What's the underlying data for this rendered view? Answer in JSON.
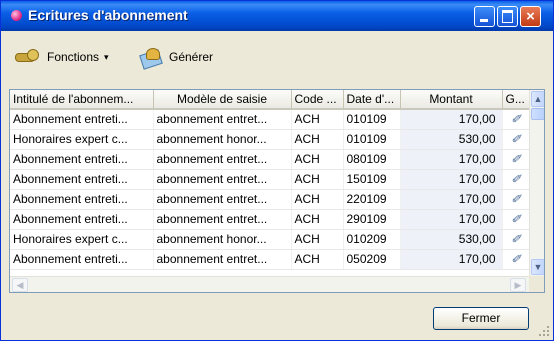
{
  "window": {
    "title": "Ecritures d'abonnement",
    "controls": {
      "minimize": "minimize",
      "maximize": "maximize",
      "close": "×"
    }
  },
  "toolbar": {
    "fonctions_label": "Fonctions",
    "fonctions_caret": "▾",
    "fonctions_icon": "keys-icon",
    "generer_label": "Générer",
    "generer_icon": "generate-icon"
  },
  "table": {
    "columns": [
      "Intitulé de l'abonnem...",
      "Modèle de saisie",
      "Code ...",
      "Date d'...",
      "Montant",
      "G..."
    ],
    "rows": [
      {
        "intitule": "Abonnement entreti...",
        "modele": "abonnement entret...",
        "code": "ACH",
        "date": "010109",
        "montant": "170,00",
        "g": "✐"
      },
      {
        "intitule": "Honoraires expert c...",
        "modele": "abonnement honor...",
        "code": "ACH",
        "date": "010109",
        "montant": "530,00",
        "g": "✐"
      },
      {
        "intitule": "Abonnement entreti...",
        "modele": "abonnement entret...",
        "code": "ACH",
        "date": "080109",
        "montant": "170,00",
        "g": "✐"
      },
      {
        "intitule": "Abonnement entreti...",
        "modele": "abonnement entret...",
        "code": "ACH",
        "date": "150109",
        "montant": "170,00",
        "g": "✐"
      },
      {
        "intitule": "Abonnement entreti...",
        "modele": "abonnement entret...",
        "code": "ACH",
        "date": "220109",
        "montant": "170,00",
        "g": "✐"
      },
      {
        "intitule": "Abonnement entreti...",
        "modele": "abonnement entret...",
        "code": "ACH",
        "date": "290109",
        "montant": "170,00",
        "g": "✐"
      },
      {
        "intitule": "Honoraires expert c...",
        "modele": "abonnement honor...",
        "code": "ACH",
        "date": "010209",
        "montant": "530,00",
        "g": "✐"
      },
      {
        "intitule": "Abonnement entreti...",
        "modele": "abonnement entret...",
        "code": "ACH",
        "date": "050209",
        "montant": "170,00",
        "g": "✐"
      }
    ]
  },
  "scroll": {
    "up": "▲",
    "down": "▼",
    "left": "◀",
    "right": "▶"
  },
  "footer": {
    "close_button_label": "Fermer"
  },
  "colors": {
    "titlebar": "#0a5fe6",
    "window_bg": "#ece9d8",
    "close_button": "#c23a14",
    "grid_border": "#7f9db9"
  }
}
